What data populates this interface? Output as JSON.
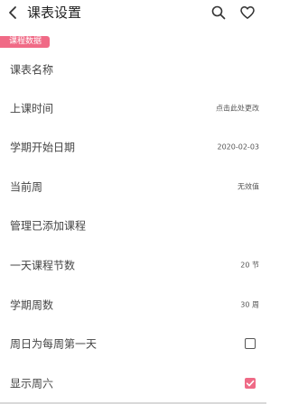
{
  "header": {
    "title": "课表设置",
    "back_icon": "chevron-left-icon",
    "search_icon": "search-icon",
    "favorite_icon": "heart-outline-icon"
  },
  "section": {
    "label": "课程数据",
    "color": "#f06a86"
  },
  "rows": [
    {
      "label": "课表名称",
      "value": ""
    },
    {
      "label": "上课时间",
      "value": "点击此处更改"
    },
    {
      "label": "学期开始日期",
      "value": "2020-02-03"
    },
    {
      "label": "当前周",
      "value": "无效值"
    },
    {
      "label": "管理已添加课程",
      "value": ""
    },
    {
      "label": "一天课程节数",
      "value": "20 节"
    },
    {
      "label": "学期周数",
      "value": "30 周"
    },
    {
      "label": "周日为每周第一天",
      "checked": false
    },
    {
      "label": "显示周六",
      "checked": true
    }
  ],
  "accent_color": "#ef6a86"
}
